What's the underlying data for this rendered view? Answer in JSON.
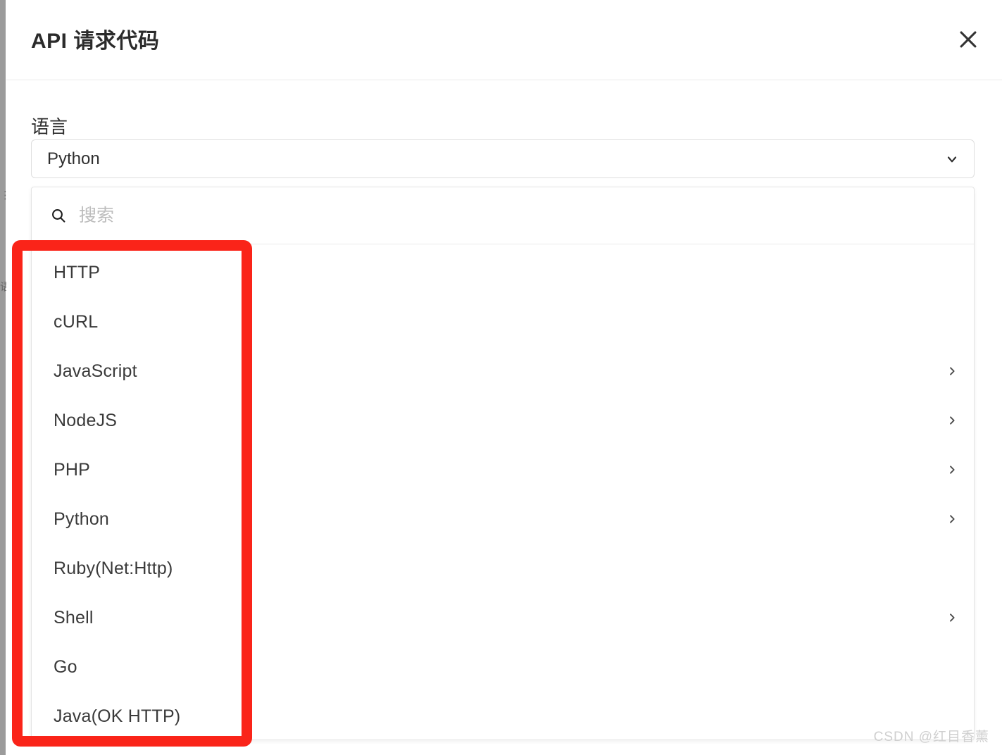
{
  "window": {
    "title": "API 请求代码",
    "close_icon": "close-icon"
  },
  "gutter": {
    "ghost_text_top": "⋮",
    "ghost_text_bottom": "语"
  },
  "form": {
    "language_label": "语言",
    "language_selected": "Python",
    "chevron_icon": "chevron-down-icon"
  },
  "dropdown": {
    "search": {
      "icon": "search-icon",
      "placeholder": "搜索",
      "value": ""
    },
    "options": [
      {
        "label": "HTTP",
        "has_submenu": false
      },
      {
        "label": "cURL",
        "has_submenu": false
      },
      {
        "label": "JavaScript",
        "has_submenu": true
      },
      {
        "label": "NodeJS",
        "has_submenu": true
      },
      {
        "label": "PHP",
        "has_submenu": true
      },
      {
        "label": "Python",
        "has_submenu": true
      },
      {
        "label": "Ruby(Net:Http)",
        "has_submenu": false
      },
      {
        "label": "Shell",
        "has_submenu": true
      },
      {
        "label": "Go",
        "has_submenu": false
      },
      {
        "label": "Java(OK HTTP)",
        "has_submenu": false
      }
    ],
    "submenu_icon": "chevron-right-icon"
  },
  "annotation": {
    "color": "#fa2419"
  },
  "watermark": {
    "text": "CSDN @红目香薰"
  }
}
